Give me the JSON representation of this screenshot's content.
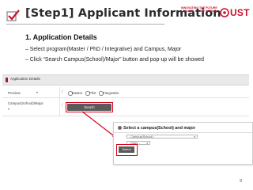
{
  "header": {
    "title": "[Step1] Applicant Information",
    "logo_slogan": [
      "INNOVATING",
      "LEADING",
      "THE FUTURE",
      "THE WORLD"
    ],
    "logo_name": "UST"
  },
  "instructions": {
    "title": "1.  Application Details",
    "bullets": [
      "–  Select program(Master / PhD / Integrative) and Campus, Major",
      "–  Click  “Search Campus(School)/Major”  button and pop-up will be showed"
    ]
  },
  "form": {
    "section_title": "Application Details",
    "rows": [
      {
        "label": "Preview",
        "value": "▾"
      },
      {
        "label": "Campus(School)/Major",
        "value": "▾"
      }
    ],
    "program_options": [
      "Master",
      "PhD",
      "Integrative"
    ],
    "search_button": "Search Campus(School)/Major"
  },
  "popup": {
    "title": "Select a campus(School) and major",
    "campus_select": "- Campus(School) -",
    "major_select": "- Major -",
    "select_button": "Select"
  },
  "colors": {
    "accent": "#d6001c",
    "brand": "#c8102e"
  },
  "page_number": "9"
}
